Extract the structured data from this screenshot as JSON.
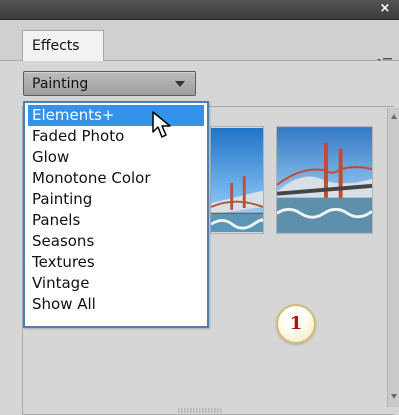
{
  "window": {
    "close_symbol": "×"
  },
  "tabs": [
    {
      "label": "Effects"
    }
  ],
  "category_select": {
    "value": "Painting"
  },
  "dropdown": {
    "items": [
      {
        "label": "Elements+"
      },
      {
        "label": "Faded Photo"
      },
      {
        "label": "Glow"
      },
      {
        "label": "Monotone Color"
      },
      {
        "label": "Painting"
      },
      {
        "label": "Panels"
      },
      {
        "label": "Seasons"
      },
      {
        "label": "Textures"
      },
      {
        "label": "Vintage"
      },
      {
        "label": "Show All"
      }
    ]
  },
  "badge": {
    "number": "1"
  },
  "icons": {
    "panel_menu": "panel-menu-icon",
    "chevron": "chevron-down-icon",
    "scroll_up": "scroll-up-arrow-icon",
    "scroll_down": "scroll-down-arrow-icon",
    "cursor": "mouse-pointer-icon",
    "grip": "resize-grip-icon"
  },
  "colors": {
    "selection": "#3392ea",
    "badge_text": "#b1120a"
  }
}
